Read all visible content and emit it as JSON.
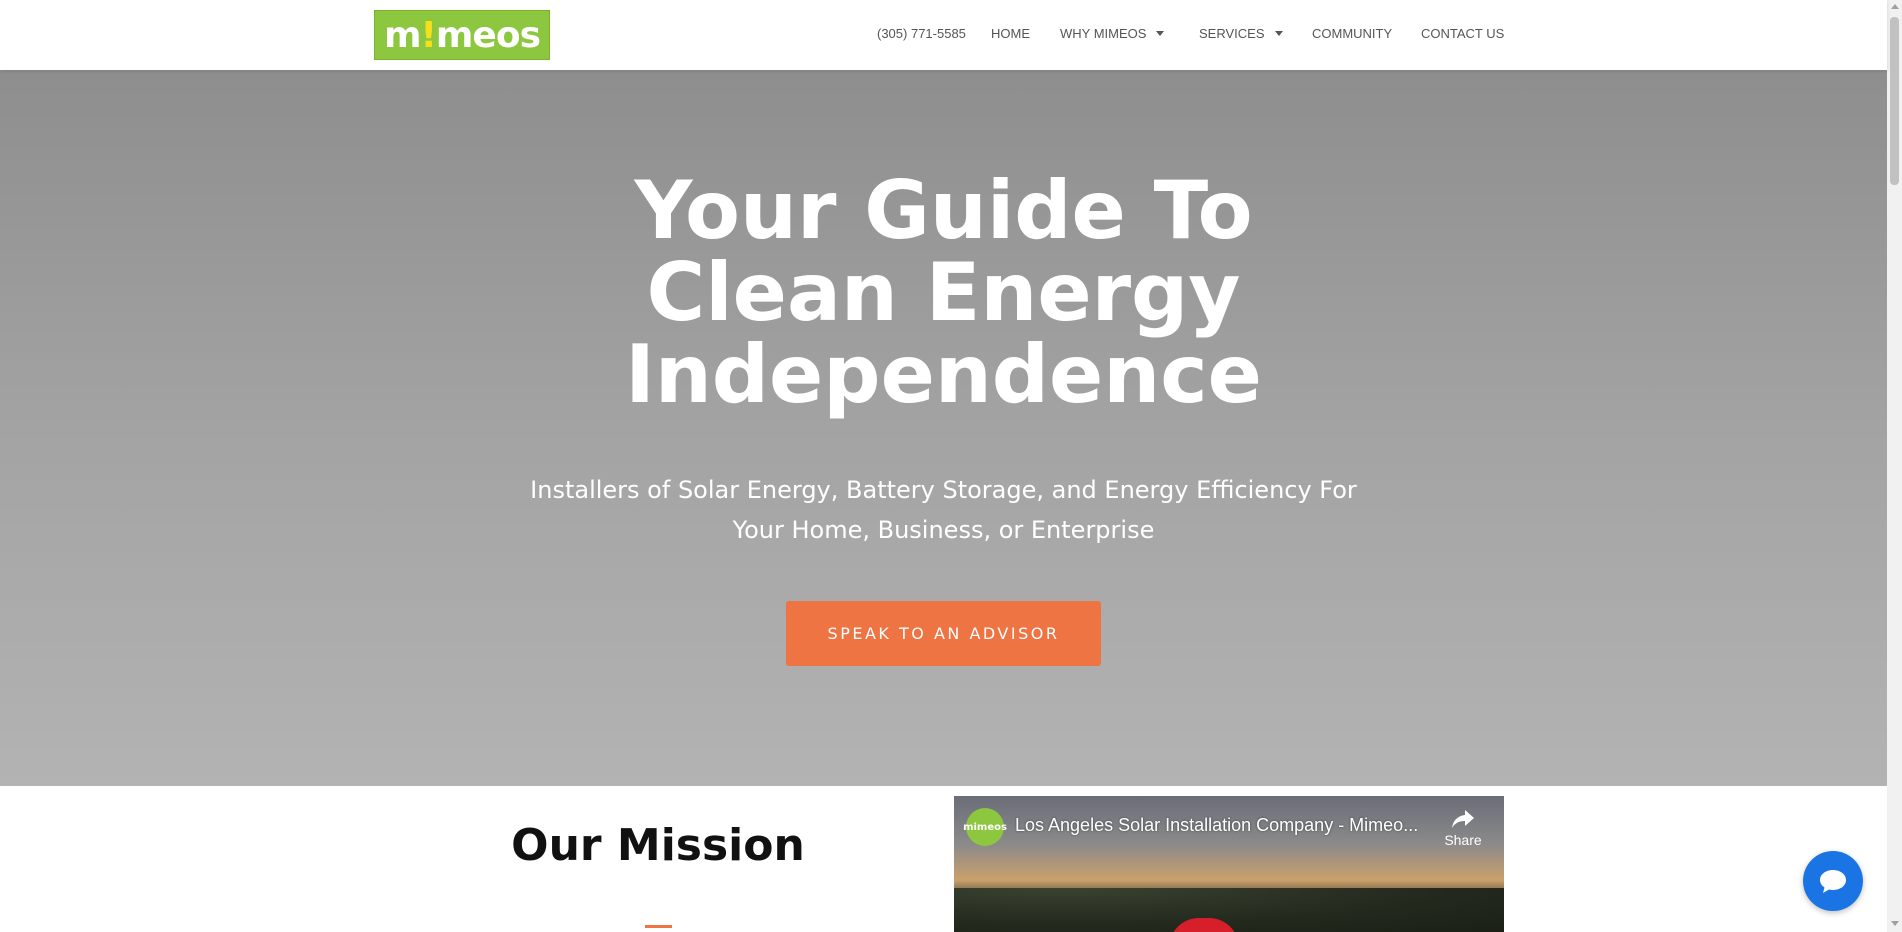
{
  "header": {
    "logo": {
      "pre": "m",
      "bang": "!",
      "post": "meos"
    },
    "nav": [
      {
        "label": "(305) 771-5585",
        "has_caret": false
      },
      {
        "label": "HOME",
        "has_caret": false
      },
      {
        "label": "WHY MIMEOS",
        "has_caret": true
      },
      {
        "label": "SERVICES",
        "has_caret": true
      },
      {
        "label": "COMMUNITY",
        "has_caret": false
      },
      {
        "label": "CONTACT US",
        "has_caret": false
      }
    ]
  },
  "hero": {
    "title_lines": [
      "Your Guide To",
      "Clean Energy",
      "Independence"
    ],
    "subtitle_lines": [
      "Installers of Solar Energy, Battery Storage, and Energy Efficiency For",
      "Your Home, Business, or Enterprise"
    ],
    "cta_label": "SPEAK TO AN ADVISOR"
  },
  "mission": {
    "title": "Our Mission"
  },
  "video": {
    "channel_badge": "mimeos",
    "title": "Los Angeles Solar Installation Company - Mimeo...",
    "share_label": "Share"
  },
  "colors": {
    "brand_green": "#8dc63f",
    "accent_orange": "#ee7443",
    "chat_blue": "#1b74e4"
  },
  "icons": {
    "share": "share-arrow-icon",
    "chat": "chat-bubble-icon",
    "caret": "caret-down-icon"
  }
}
